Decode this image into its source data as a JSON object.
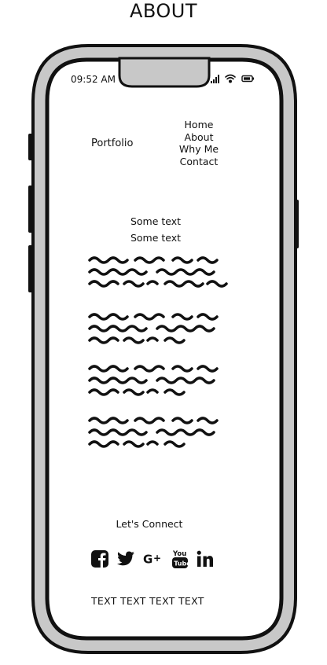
{
  "page": {
    "heading": "ABOUT"
  },
  "status_bar": {
    "time": "09:52 AM",
    "icons": [
      "signal-icon",
      "wifi-icon",
      "battery-icon"
    ]
  },
  "header": {
    "brand": "Portfolio",
    "nav": [
      "Home",
      "About",
      "Why Me",
      "Contact"
    ]
  },
  "content": {
    "lines": [
      "Some text",
      "Some text"
    ],
    "paragraphs": [
      {
        "lines": 3
      },
      {
        "lines": 3
      },
      {
        "lines": 3
      },
      {
        "lines": 3
      }
    ]
  },
  "footer": {
    "connect_label": "Let's Connect",
    "socials": [
      "facebook-icon",
      "twitter-icon",
      "google-plus-icon",
      "youtube-icon",
      "linkedin-icon"
    ],
    "youtube_text": "You Tube",
    "text": "TEXT TEXT TEXT TEXT"
  },
  "colors": {
    "frame": "#c8c8c8",
    "stroke": "#111111",
    "screen": "#ffffff"
  }
}
